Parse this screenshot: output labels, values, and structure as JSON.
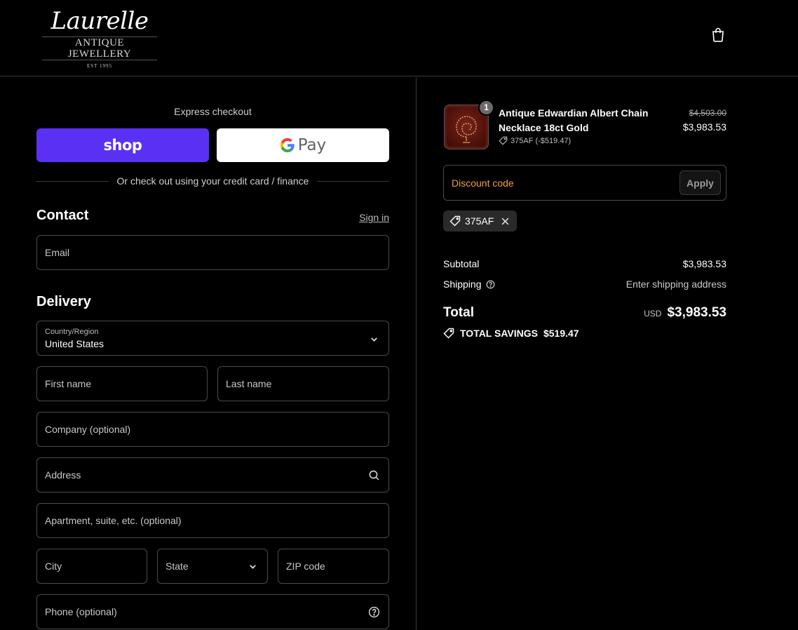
{
  "brand": {
    "name": "Laurelle",
    "tagline": "ANTIQUE JEWELLERY",
    "est": "EST 1995"
  },
  "express": {
    "title": "Express checkout",
    "shop_label": "shop",
    "gpay_label": "Pay",
    "divider_text": "Or check out using your credit card / finance"
  },
  "contact": {
    "title": "Contact",
    "signin": "Sign in",
    "email_placeholder": "Email"
  },
  "delivery": {
    "title": "Delivery",
    "country_label": "Country/Region",
    "country_value": "United States",
    "first_name": "First name",
    "last_name": "Last name",
    "company": "Company (optional)",
    "address": "Address",
    "apartment": "Apartment, suite, etc. (optional)",
    "city": "City",
    "state": "State",
    "zip": "ZIP code",
    "phone": "Phone (optional)"
  },
  "summary": {
    "product": {
      "quantity": "1",
      "name": "Antique Edwardian Albert Chain Necklace 18ct Gold",
      "discount_tag": "375AF (-$519.47)",
      "price_original": "$4,503.00",
      "price_current": "$3,983.53"
    },
    "discount_placeholder": "Discount code",
    "apply_label": "Apply",
    "applied_code": "375AF",
    "subtotal_label": "Subtotal",
    "subtotal_value": "$3,983.53",
    "shipping_label": "Shipping",
    "shipping_value": "Enter shipping address",
    "total_label": "Total",
    "total_currency": "USD",
    "total_value": "$3,983.53",
    "savings_label": "TOTAL SAVINGS",
    "savings_value": "$519.47"
  },
  "colors": {
    "shop_purple": "#5a31f4",
    "discount_placeholder": "#f0a040",
    "background": "#000000"
  }
}
